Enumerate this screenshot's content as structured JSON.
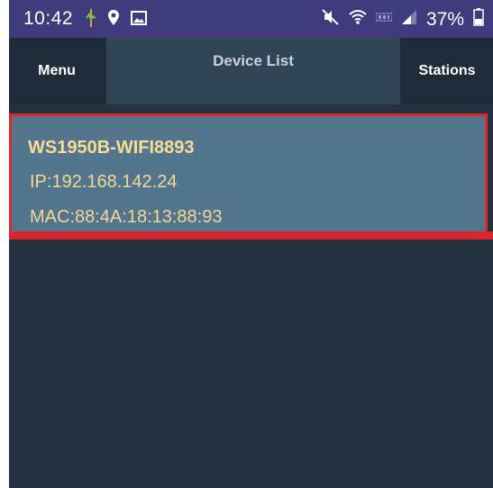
{
  "status_bar": {
    "time": "10:42",
    "battery": "37%",
    "left_icons": [
      "activity-icon",
      "location-pin-icon",
      "image-icon"
    ],
    "right_icons": [
      "mute-icon",
      "wifi-icon",
      "lte-icon",
      "signal-icon",
      "battery-icon"
    ]
  },
  "header": {
    "menu_label": "Menu",
    "title": "Device List",
    "stations_label": "Stations"
  },
  "devices": [
    {
      "name": "WS1950B-WIFI8893",
      "ip": "IP:192.168.142.24",
      "mac": "MAC:88:4A:18:13:88:93",
      "highlighted": true
    }
  ],
  "colors": {
    "status_bar_bg": "#3f3b7c",
    "header_bg": "#1f2b38",
    "title_box_bg": "#304556",
    "list_bg": "#25313f",
    "card_bg": "#54768c",
    "highlight_border": "#e0262b",
    "device_text": "#f1d79a"
  }
}
